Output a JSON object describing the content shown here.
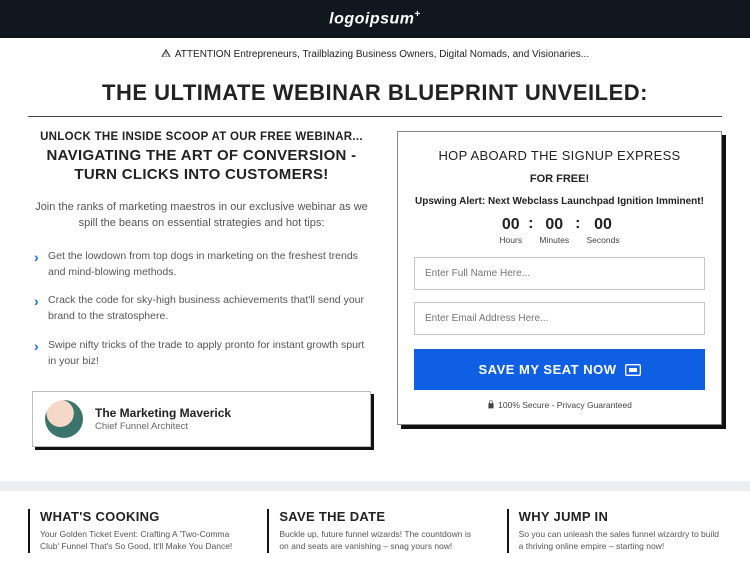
{
  "header": {
    "logo": "logoipsum"
  },
  "attention": "ATTENTION Entrepreneurs, Trailblazing Business Owners, Digital Nomads, and Visionaries...",
  "main_title": "THE ULTIMATE WEBINAR BLUEPRINT UNVEILED:",
  "left": {
    "unlock": "UNLOCK THE INSIDE SCOOP AT OUR FREE WEBINAR...",
    "subtitle": "NAVIGATING THE ART OF CONVERSION - TURN CLICKS INTO CUSTOMERS!",
    "intro": "Join the ranks of marketing maestros in our exclusive webinar as we spill the beans on essential strategies and hot tips:",
    "bullets": [
      "Get the lowdown from top dogs in marketing on the freshest trends and mind-blowing methods.",
      "Crack the code for sky-high business achievements that'll send your brand to the stratosphere.",
      "Swipe nifty tricks of the trade to apply pronto for instant growth spurt in your biz!"
    ],
    "profile": {
      "name": "The Marketing Maverick",
      "role": "Chief Funnel Architect"
    }
  },
  "signup": {
    "title": "HOP ABOARD THE SIGNUP EXPRESS",
    "free": "FOR FREE!",
    "alert": "Upswing Alert: Next Webclass Launchpad Ignition Imminent!",
    "countdown": {
      "hours_val": "00",
      "hours_lab": "Hours",
      "minutes_val": "00",
      "minutes_lab": "Minutes",
      "seconds_val": "00",
      "seconds_lab": "Seconds"
    },
    "name_placeholder": "Enter Full Name Here...",
    "email_placeholder": "Enter Email Address Here...",
    "cta": "SAVE MY SEAT NOW",
    "secure": "100% Secure - Privacy Guaranteed"
  },
  "columns": [
    {
      "title": "WHAT'S COOKING",
      "text": "Your Golden Ticket Event: Crafting A 'Two-Comma Club' Funnel That's So Good, It'll Make You Dance!"
    },
    {
      "title": "SAVE THE DATE",
      "text": "Buckle up, future funnel wizards! The countdown is on and seats are vanishing – snag yours now!"
    },
    {
      "title": "WHY JUMP IN",
      "text": "So you can unleash the sales funnel wizardry to build a thriving online empire – starting now!"
    }
  ]
}
